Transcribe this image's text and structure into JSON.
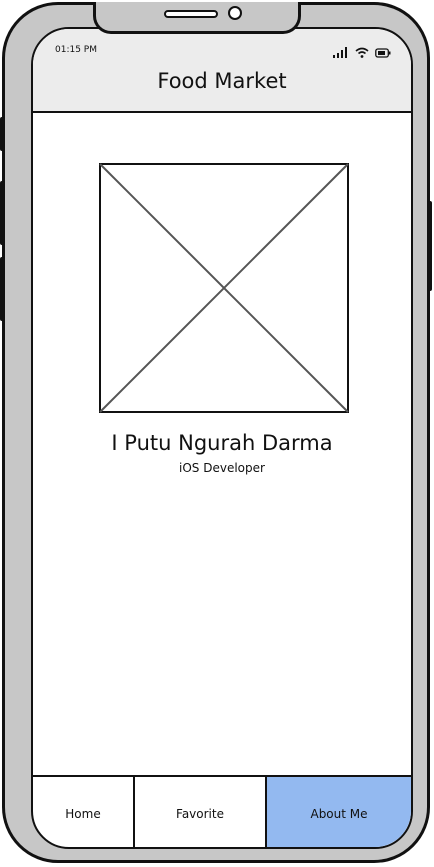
{
  "status_bar": {
    "time": "01:15 PM"
  },
  "header": {
    "title": "Food Market"
  },
  "profile": {
    "name": "I Putu Ngurah Darma",
    "role": "iOS Developer"
  },
  "tabs": [
    {
      "label": "Home",
      "active": false
    },
    {
      "label": "Favorite",
      "active": false
    },
    {
      "label": "About Me",
      "active": true
    }
  ],
  "colors": {
    "active_tab": "#93b9f0",
    "header_bg": "#ececec",
    "frame": "#c7c7c7"
  }
}
